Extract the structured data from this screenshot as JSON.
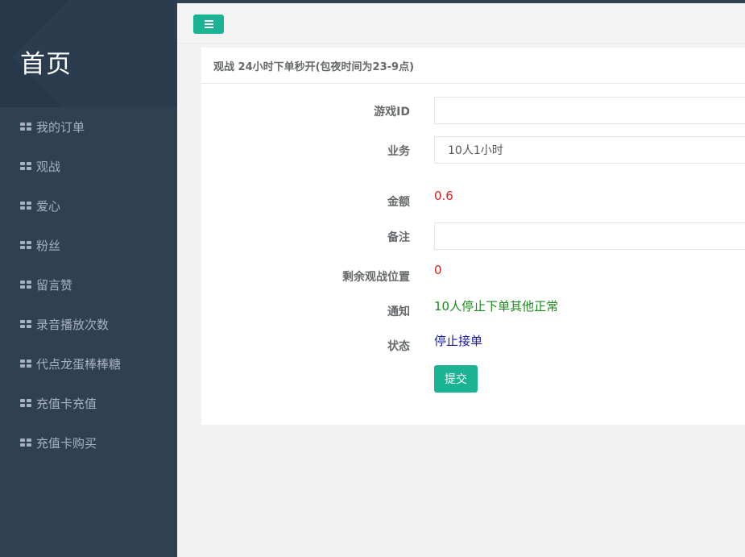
{
  "sidebar": {
    "brand_title": "首页",
    "items": [
      {
        "label": "我的订单"
      },
      {
        "label": "观战"
      },
      {
        "label": "爱心"
      },
      {
        "label": "粉丝"
      },
      {
        "label": "留言赞"
      },
      {
        "label": "录音播放次数"
      },
      {
        "label": "代点龙蛋棒棒糖"
      },
      {
        "label": "充值卡充值"
      },
      {
        "label": "充值卡购买"
      }
    ]
  },
  "panel": {
    "title": "观战 24小时下单秒开(包夜时间为23-9点)"
  },
  "form": {
    "game_id_label": "游戏ID",
    "game_id_value": "",
    "service_label": "业务",
    "service_value": "10人1小时",
    "amount_label": "金额",
    "amount_value": "0.6",
    "note_label": "备注",
    "note_value": "",
    "remaining_label": "剩余观战位置",
    "remaining_value": "0",
    "notice_label": "通知",
    "notice_value": "10人停止下单其他正常",
    "status_label": "状态",
    "status_value": "停止接单",
    "submit_label": "提交"
  },
  "colors": {
    "accent": "#1ab394",
    "sidebar_bg": "#2f4050",
    "amount": "#d9241a",
    "notice": "#1a8a1a",
    "status": "#1a1aa0"
  },
  "icons": {
    "menu": "hamburger-icon",
    "nav_item": "grid-icon"
  }
}
